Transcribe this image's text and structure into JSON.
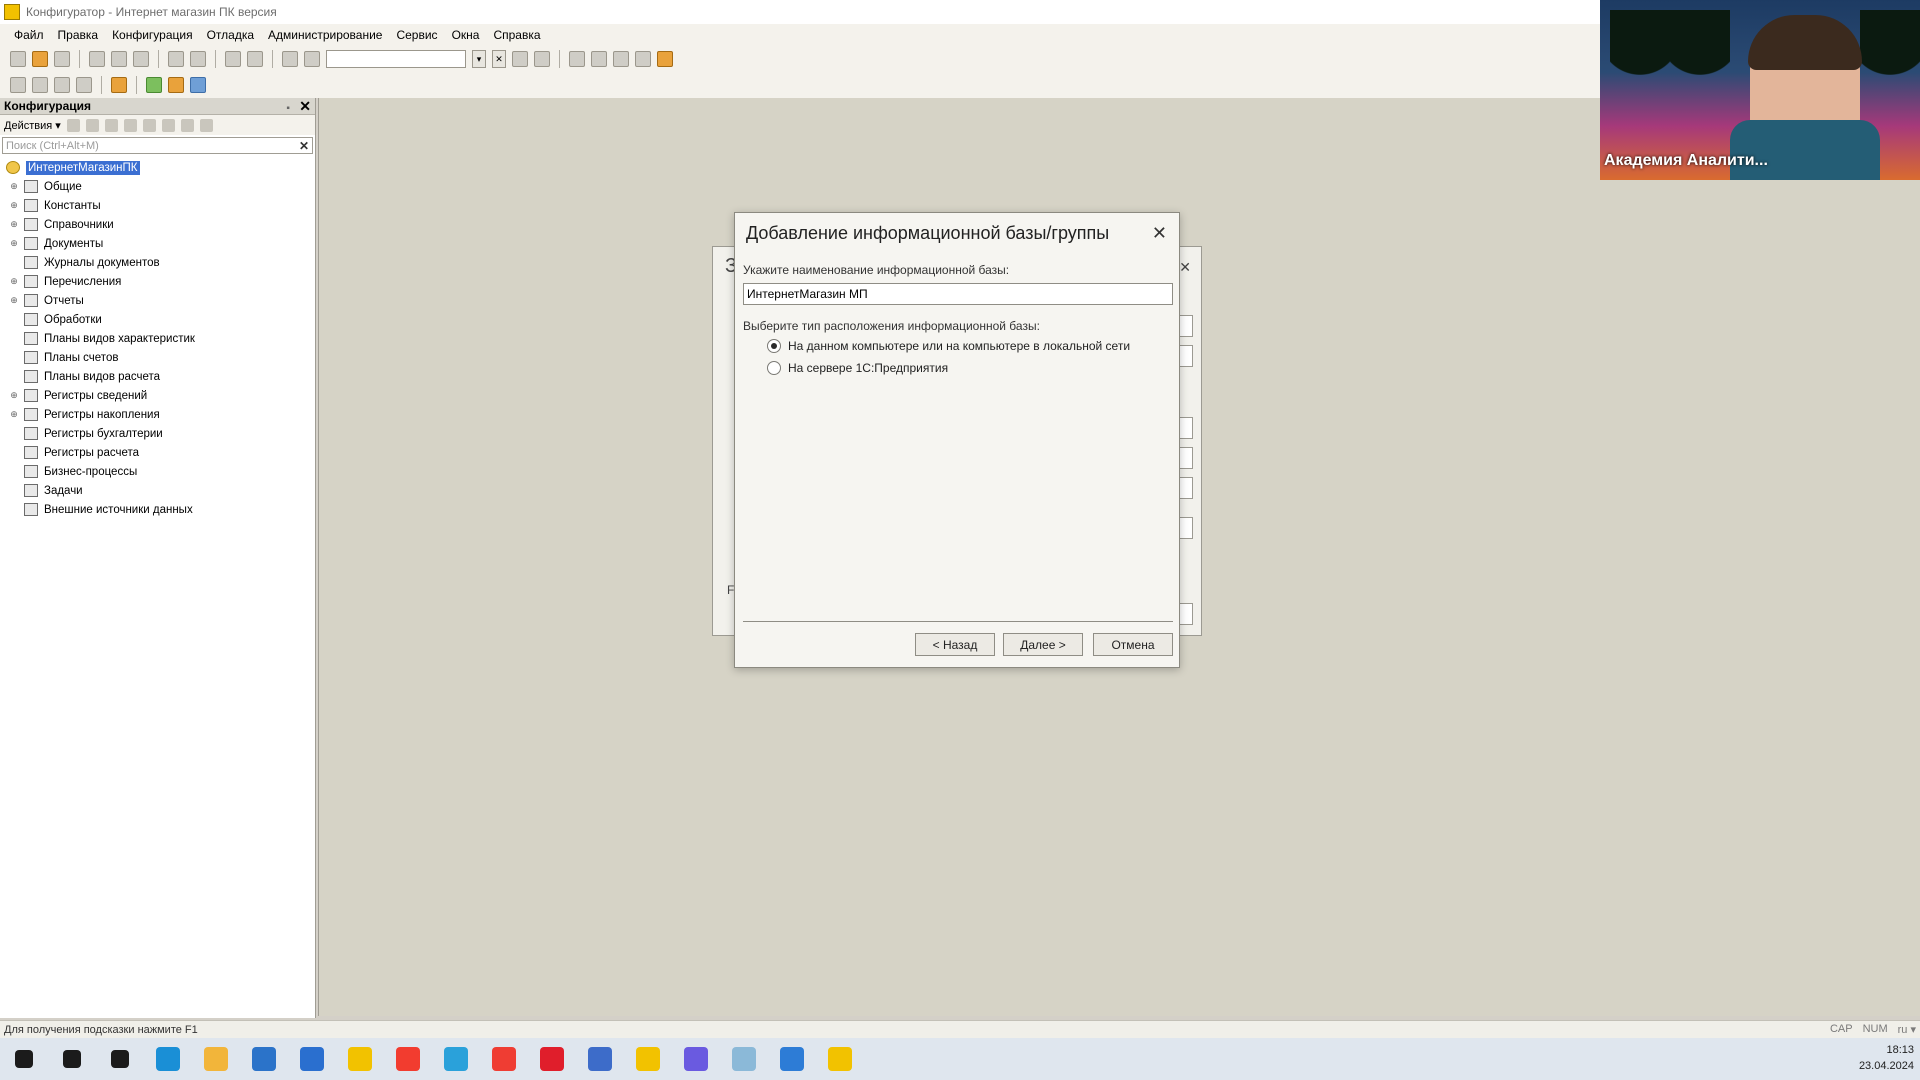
{
  "window": {
    "title": "Конфигуратор - Интернет магазин ПК версия"
  },
  "menu": [
    "Файл",
    "Правка",
    "Конфигурация",
    "Отладка",
    "Администрирование",
    "Сервис",
    "Окна",
    "Справка"
  ],
  "config_panel": {
    "title": "Конфигурация",
    "actions_label": "Действия",
    "search_placeholder": "Поиск (Ctrl+Alt+M)",
    "tree": [
      {
        "label": "ИнтернетМагазинПК",
        "root": true,
        "expandable": false
      },
      {
        "label": "Общие",
        "expandable": true
      },
      {
        "label": "Константы",
        "expandable": true
      },
      {
        "label": "Справочники",
        "expandable": true
      },
      {
        "label": "Документы",
        "expandable": true
      },
      {
        "label": "Журналы документов",
        "expandable": false
      },
      {
        "label": "Перечисления",
        "expandable": true
      },
      {
        "label": "Отчеты",
        "expandable": true
      },
      {
        "label": "Обработки",
        "expandable": false
      },
      {
        "label": "Планы видов характеристик",
        "expandable": false
      },
      {
        "label": "Планы счетов",
        "expandable": false
      },
      {
        "label": "Планы видов расчета",
        "expandable": false
      },
      {
        "label": "Регистры сведений",
        "expandable": true
      },
      {
        "label": "Регистры накопления",
        "expandable": true
      },
      {
        "label": "Регистры бухгалтерии",
        "expandable": false
      },
      {
        "label": "Регистры расчета",
        "expandable": false
      },
      {
        "label": "Бизнес-процессы",
        "expandable": false
      },
      {
        "label": "Задачи",
        "expandable": false
      },
      {
        "label": "Внешние источники данных",
        "expandable": false
      }
    ]
  },
  "bg_dialog": {
    "title_fragment": "З",
    "bottom_fragment": "F"
  },
  "dialog": {
    "title": "Добавление информационной базы/группы",
    "name_label": "Укажите наименование информационной базы:",
    "name_value": "ИнтернетМагазин МП",
    "type_label": "Выберите тип расположения информационной базы:",
    "options": [
      {
        "label": "На данном компьютере или на компьютере в локальной сети",
        "selected": true
      },
      {
        "label": "На сервере 1С:Предприятия",
        "selected": false
      }
    ],
    "buttons": {
      "back": "< Назад",
      "next": "Далее >",
      "cancel": "Отмена"
    }
  },
  "statusbar": {
    "hint": "Для получения подсказки нажмите F1",
    "indicators": [
      "CAP",
      "NUM",
      "ru ▾"
    ]
  },
  "webcam": {
    "caption": "Академия Аналити..."
  },
  "taskbar": {
    "time": "18:13",
    "date": "23.04.2024",
    "apps": [
      {
        "name": "start-icon",
        "color": "#1b1b1b"
      },
      {
        "name": "search-icon",
        "color": "#1b1b1b"
      },
      {
        "name": "task-view-icon",
        "color": "#1b1b1b"
      },
      {
        "name": "edge-icon",
        "color": "#1a8fd6"
      },
      {
        "name": "explorer-icon",
        "color": "#f2b53a"
      },
      {
        "name": "store-icon",
        "color": "#2b73c9"
      },
      {
        "name": "mail-icon",
        "color": "#2a6fcf"
      },
      {
        "name": "yandex-browser-icon",
        "color": "#f2c200"
      },
      {
        "name": "yandex-icon",
        "color": "#f23c2f"
      },
      {
        "name": "telegram-icon",
        "color": "#2aa1da"
      },
      {
        "name": "anydesk-icon",
        "color": "#ef3d33"
      },
      {
        "name": "opera-icon",
        "color": "#e01e2b"
      },
      {
        "name": "1c-designer-icon",
        "color": "#3d6cc9"
      },
      {
        "name": "1c-icon",
        "color": "#f2c200"
      },
      {
        "name": "discord-icon",
        "color": "#6a5ae0"
      },
      {
        "name": "notepad-icon",
        "color": "#8bb9d8"
      },
      {
        "name": "zoom-icon",
        "color": "#2d7cd6"
      },
      {
        "name": "1c-enterprise-icon",
        "color": "#f2c200"
      }
    ]
  }
}
